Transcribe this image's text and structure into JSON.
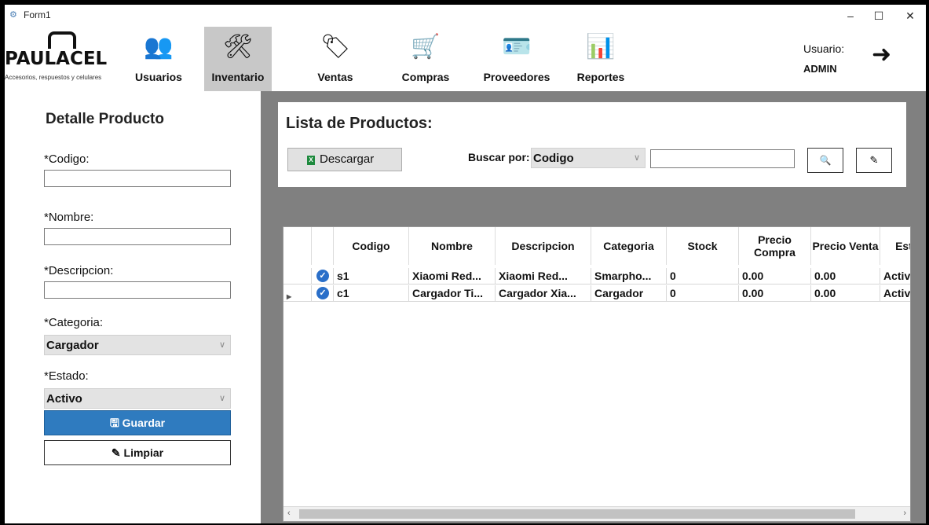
{
  "window": {
    "title": "Form1",
    "min": "–",
    "max": "☐",
    "close": "✕"
  },
  "logo": {
    "brand": "PAULACEL",
    "tagline": "Accesorios, respuestos y celulares"
  },
  "menu": [
    {
      "label": "Usuarios",
      "icon": "👥"
    },
    {
      "label": "Inventario",
      "icon": "🛠"
    },
    {
      "label": "Ventas",
      "icon": "🏷"
    },
    {
      "label": "Compras",
      "icon": "🛒"
    },
    {
      "label": "Proveedores",
      "icon": "🪪"
    },
    {
      "label": "Reportes",
      "icon": "📊"
    }
  ],
  "user": {
    "label": "Usuario:",
    "name": "ADMIN",
    "logout_icon": "➜"
  },
  "detalle": {
    "title": "Detalle Producto",
    "codigo_label": "*Codigo:",
    "nombre_label": "*Nombre:",
    "descripcion_label": "*Descripcion:",
    "categoria_label": "*Categoria:",
    "categoria_value": "Cargador",
    "estado_label": "*Estado:",
    "estado_value": "Activo",
    "guardar": "Guardar",
    "limpiar": "Limpiar"
  },
  "lista": {
    "title": "Lista de Productos:",
    "descargar": "Descargar",
    "buscar_label": "Buscar por:",
    "buscar_value": "Codigo"
  },
  "grid": {
    "columns": [
      "Codigo",
      "Nombre",
      "Descripcion",
      "Categoria",
      "Stock",
      "Precio Compra",
      "Precio Venta",
      "Est"
    ],
    "rows": [
      [
        "s1",
        "Xiaomi Red...",
        "Xiaomi Red...",
        "Smarpho...",
        "0",
        "0.00",
        "0.00",
        "Activ"
      ],
      [
        "c1",
        "Cargador Ti...",
        "Cargador Xia...",
        "Cargador",
        "0",
        "0.00",
        "0.00",
        "Activ"
      ]
    ]
  }
}
